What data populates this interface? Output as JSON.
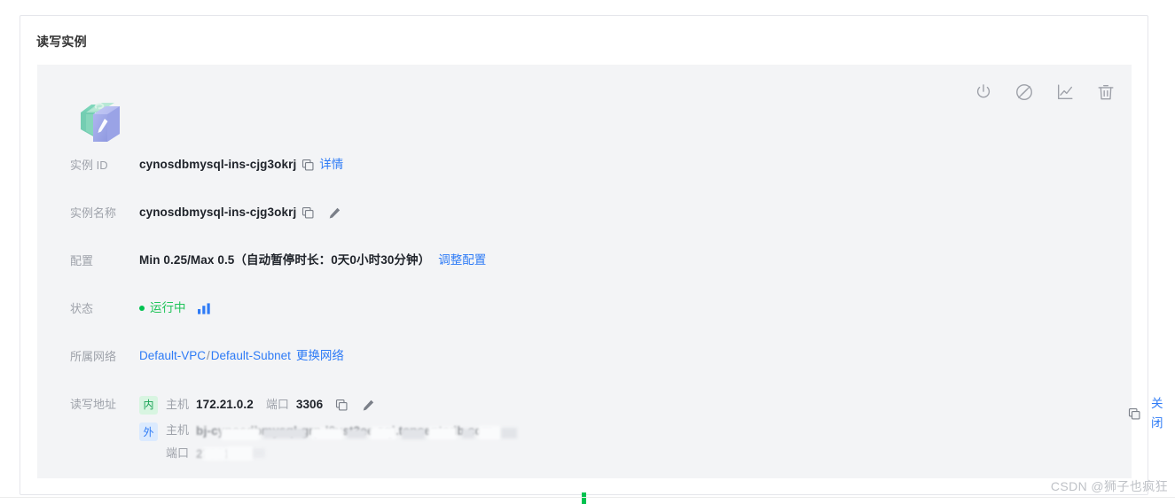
{
  "card": {
    "title": "读写实例"
  },
  "actions": [
    {
      "name": "power-icon",
      "label": "开关机"
    },
    {
      "name": "gauge-slash-icon",
      "label": "性能"
    },
    {
      "name": "line-chart-icon",
      "label": "监控"
    },
    {
      "name": "trash-icon",
      "label": "销毁"
    }
  ],
  "instance_icon": {
    "name": "database-instance-icon",
    "colors": {
      "front": "#9fa8e8",
      "back": "#7fd2bb",
      "pen": "#ffffff"
    }
  },
  "fields": {
    "instance_id": {
      "label": "实例 ID",
      "value": "cynosdbmysql-ins-cjg3okrj",
      "copy_icon": "copy-icon",
      "link": "详情"
    },
    "instance_name": {
      "label": "实例名称",
      "value": "cynosdbmysql-ins-cjg3okrj",
      "copy_icon": "copy-icon",
      "edit_icon": "pencil-icon"
    },
    "configuration": {
      "label": "配置",
      "value": "Min 0.25/Max 0.5（自动暂停时长：0天0小时30分钟）",
      "link": "调整配置"
    },
    "status": {
      "label": "状态",
      "value": "运行中",
      "dot_color": "#00c250",
      "text_color": "#21c45a",
      "monitor_icon": "bar-chart-icon"
    },
    "network": {
      "label": "所属网络",
      "vpc": "Default-VPC",
      "separator": "/",
      "subnet": "Default-Subnet",
      "link": "更换网络"
    },
    "address": {
      "label": "读写地址",
      "internal": {
        "badge": "内",
        "badge_bg": "#d8f5e1",
        "badge_color": "#1aa356",
        "host_label": "主机",
        "host_value": "172.21.0.2",
        "port_label": "端口",
        "port_value": "3306",
        "copy_icon": "copy-icon",
        "edit_icon": "pencil-icon"
      },
      "external": {
        "badge": "外",
        "badge_bg": "#dbeafe",
        "badge_color": "#2e7bf6",
        "host_label": "主机",
        "host_value_redacted": "bj-cynosdbmysql-grp-l9vst2ee.sql.tencentcdb.com",
        "port_label": "端口",
        "port_value_redacted": "27981",
        "copy_icon": "copy-icon",
        "close_link": "关闭"
      }
    }
  },
  "watermark": "CSDN @狮子也疯狂"
}
